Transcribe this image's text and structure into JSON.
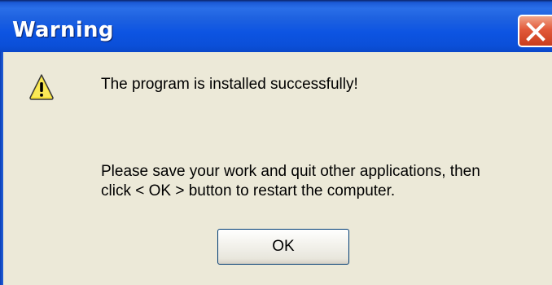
{
  "dialog": {
    "title": "Warning",
    "icon": "warning-icon",
    "message_lines": [
      "The program is installed successfully!",
      "Please save your work and quit other applications, then",
      "click < OK > button to restart the computer."
    ],
    "ok_label": "OK",
    "close_icon": "close-icon"
  },
  "colors": {
    "titlebar": "#0b4fd8",
    "client_background": "#ece9d8",
    "close_button": "#e2593a",
    "warning_icon_fill": "#f7e23a"
  }
}
